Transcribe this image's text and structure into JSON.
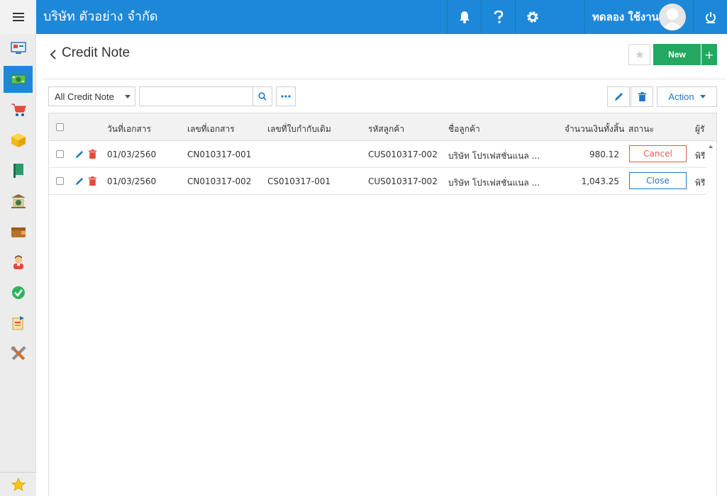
{
  "topbar": {
    "company": "บริษัท ตัวอย่าง จำกัด",
    "user_name": "ทดลอง ใช้งาน",
    "icons": [
      "bell-icon",
      "help-icon",
      "gear-icon",
      "power-icon"
    ]
  },
  "sidebar": {
    "items": [
      {
        "icon": "dashboard-icon"
      },
      {
        "icon": "money-icon",
        "active": true
      },
      {
        "icon": "cart-icon"
      },
      {
        "icon": "box-icon"
      },
      {
        "icon": "book-icon"
      },
      {
        "icon": "bank-icon"
      },
      {
        "icon": "wallet-icon"
      },
      {
        "icon": "person-icon"
      },
      {
        "icon": "check-icon"
      },
      {
        "icon": "report-icon"
      },
      {
        "icon": "tools-icon"
      }
    ],
    "favorite_icon": "star-icon"
  },
  "page": {
    "title": "Credit Note",
    "new_label": "New",
    "plus_label": "+"
  },
  "toolbar": {
    "filter_value": "All Credit Note",
    "search_value": "",
    "search_placeholder": "",
    "more_label": "•••",
    "action_label": "Action"
  },
  "table": {
    "headers": {
      "date": "วันที่เอกสาร",
      "doc_no": "เลขที่เอกสาร",
      "ref_no": "เลขที่ใบกำกับเดิม",
      "cust_code": "รหัสลูกค้า",
      "cust_name": "ชื่อลูกค้า",
      "total": "จำนวนเงินทั้งสิ้น",
      "status": "สถานะ",
      "owner": "ผู้รั"
    },
    "rows": [
      {
        "date": "01/03/2560",
        "doc_no": "CN010317-001",
        "ref_no": "",
        "cust_code": "CUS010317-002",
        "cust_name": "บริษัท โปรเฟสชั่นแนล ...",
        "total": "980.12",
        "status": "Cancel",
        "owner": "พิรี"
      },
      {
        "date": "01/03/2560",
        "doc_no": "CN010317-002",
        "ref_no": "CS010317-001",
        "cust_code": "CUS010317-002",
        "cust_name": "บริษัท โปรเฟสชั่นแนล ...",
        "total": "1,043.25",
        "status": "Close",
        "owner": "พิรี"
      }
    ]
  },
  "colors": {
    "primary": "#1e88d8",
    "new_button": "#23a860",
    "cancel_status": "#e45b4c",
    "close_status": "#1e78c8",
    "delete_red": "#e64a3b"
  }
}
